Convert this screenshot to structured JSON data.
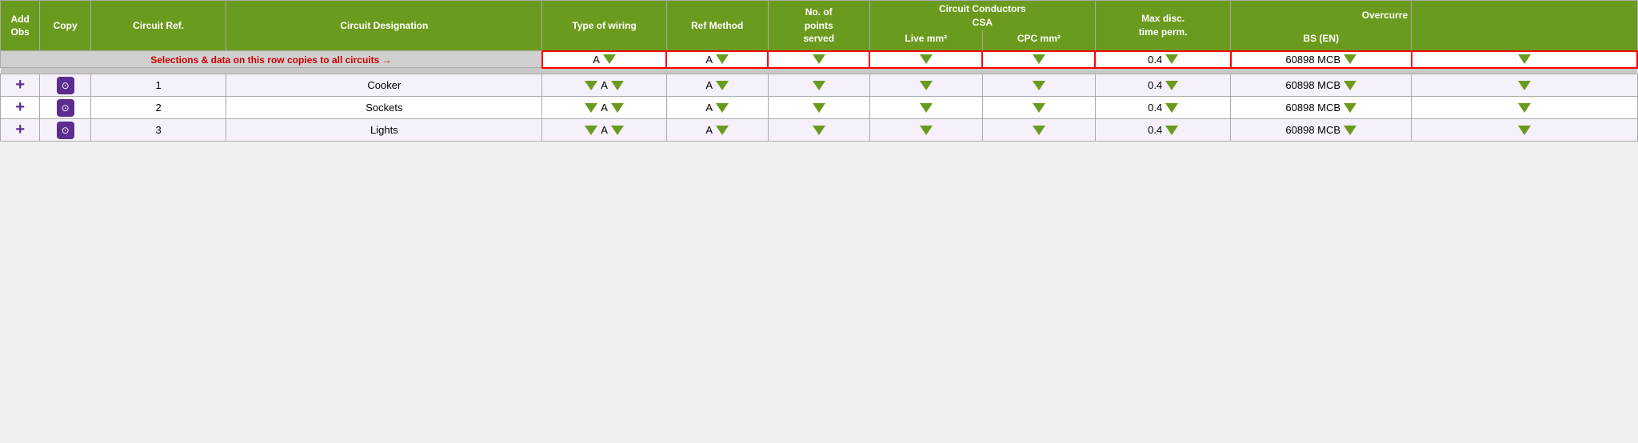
{
  "header": {
    "add_obs": "Add\nObs",
    "copy": "Copy",
    "circuit_ref": "Circuit Ref.",
    "circuit_designation": "Circuit Designation",
    "type_of_wiring": "Type of wiring",
    "ref_method": "Ref\nMethod",
    "no_of_points": "No. of\npoints\nserved",
    "circuit_conductors_csa": "Circuit Conductors\nCSA",
    "live_mm2": "Live mm²",
    "cpc_mm2": "CPC mm²",
    "max_disc_time": "Max disc.\ntime perm.",
    "overcurr": "Overcurre",
    "bs_en": "BS (EN)"
  },
  "copy_row_label": "Selections & data on this row copies to all circuits →",
  "copy_row": {
    "wiring": "A",
    "ref_method": "A",
    "max_disc": "0.4",
    "bs_en": "60898 MCB"
  },
  "circuits": [
    {
      "ref": "1",
      "designation": "Cooker",
      "wiring": "A",
      "ref_method": "A",
      "max_disc": "0.4",
      "bs_en": "60898 MCB"
    },
    {
      "ref": "2",
      "designation": "Sockets",
      "wiring": "A",
      "ref_method": "A",
      "max_disc": "0.4",
      "bs_en": "60898 MCB"
    },
    {
      "ref": "3",
      "designation": "Lights",
      "wiring": "A",
      "ref_method": "A",
      "max_disc": "0.4",
      "bs_en": "60898 MCB"
    }
  ],
  "colors": {
    "green": "#6b9b1e",
    "purple": "#5b2d8e",
    "red": "#cc0000"
  }
}
